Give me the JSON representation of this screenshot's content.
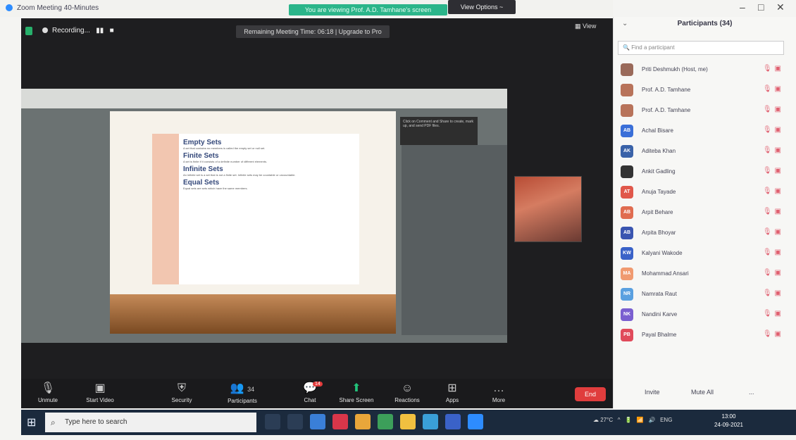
{
  "titlebar": {
    "title": "Zoom Meeting 40-Minutes",
    "share_banner": "You are viewing Prof. A.D. Tamhane's screen",
    "view_options": "View Options ~"
  },
  "meeting": {
    "recording": "Recording...",
    "remaining": "Remaining Meeting Time: 06:18 | Upgrade to Pro",
    "view": "View",
    "slide": {
      "sections": [
        {
          "heading": "Empty Sets",
          "text": "A set that contains no members is called the empty set or null set."
        },
        {
          "heading": "Finite Sets",
          "text": "A set is finite if it consists of a definite number of different elements."
        },
        {
          "heading": "Infinite Sets",
          "text": "An infinite set is a set that is not a finite set. Infinite sets may be countable or uncountable."
        },
        {
          "heading": "Equal Sets",
          "text": "Equal sets are sets which have the same members."
        }
      ],
      "hint": "Click on Comment and Share to create, mark up, and send PDF files."
    },
    "toolbar": {
      "unmute": "Unmute",
      "start_video": "Start Video",
      "security": "Security",
      "participants": "Participants",
      "participants_count": "34",
      "chat": "Chat",
      "chat_badge": "14",
      "share_screen": "Share Screen",
      "reactions": "Reactions",
      "apps": "Apps",
      "more": "More",
      "end": "End"
    }
  },
  "panel": {
    "title": "Participants (34)",
    "search_placeholder": "Find a participant",
    "participants": [
      {
        "initials": "",
        "name": "Priti Deshmukh (Host, me)",
        "color": "#9a6a5a"
      },
      {
        "initials": "",
        "name": "Prof. A.D. Tamhane",
        "color": "#b8735a"
      },
      {
        "initials": "",
        "name": "Prof. A.D. Tamhane",
        "color": "#b8735a"
      },
      {
        "initials": "AB",
        "name": "Achal Bisare",
        "color": "#3a6fd8"
      },
      {
        "initials": "AK",
        "name": "Aditeba Khan",
        "color": "#3a62a8"
      },
      {
        "initials": "",
        "name": "Ankit Gadling",
        "color": "#333333"
      },
      {
        "initials": "AT",
        "name": "Anuja Tayade",
        "color": "#e0574a"
      },
      {
        "initials": "AB",
        "name": "Arpit Behare",
        "color": "#e06c50"
      },
      {
        "initials": "AB",
        "name": "Arpita Bhoyar",
        "color": "#3a55b0"
      },
      {
        "initials": "KW",
        "name": "Kalyani Wakode",
        "color": "#3a62c8"
      },
      {
        "initials": "MA",
        "name": "Mohammad Ansari",
        "color": "#f09a70"
      },
      {
        "initials": "NR",
        "name": "Namrata Raut",
        "color": "#5aa0e0"
      },
      {
        "initials": "NK",
        "name": "Nandini Karve",
        "color": "#7a5fd0"
      },
      {
        "initials": "PB",
        "name": "Payal Bhalme",
        "color": "#e04a5a"
      }
    ],
    "invite": "Invite",
    "mute_all": "Mute All",
    "more": "..."
  },
  "taskbar": {
    "search_placeholder": "Type here to search",
    "weather": "27°C",
    "lang": "ENG",
    "time": "13:00",
    "date": "24-09-2021"
  }
}
